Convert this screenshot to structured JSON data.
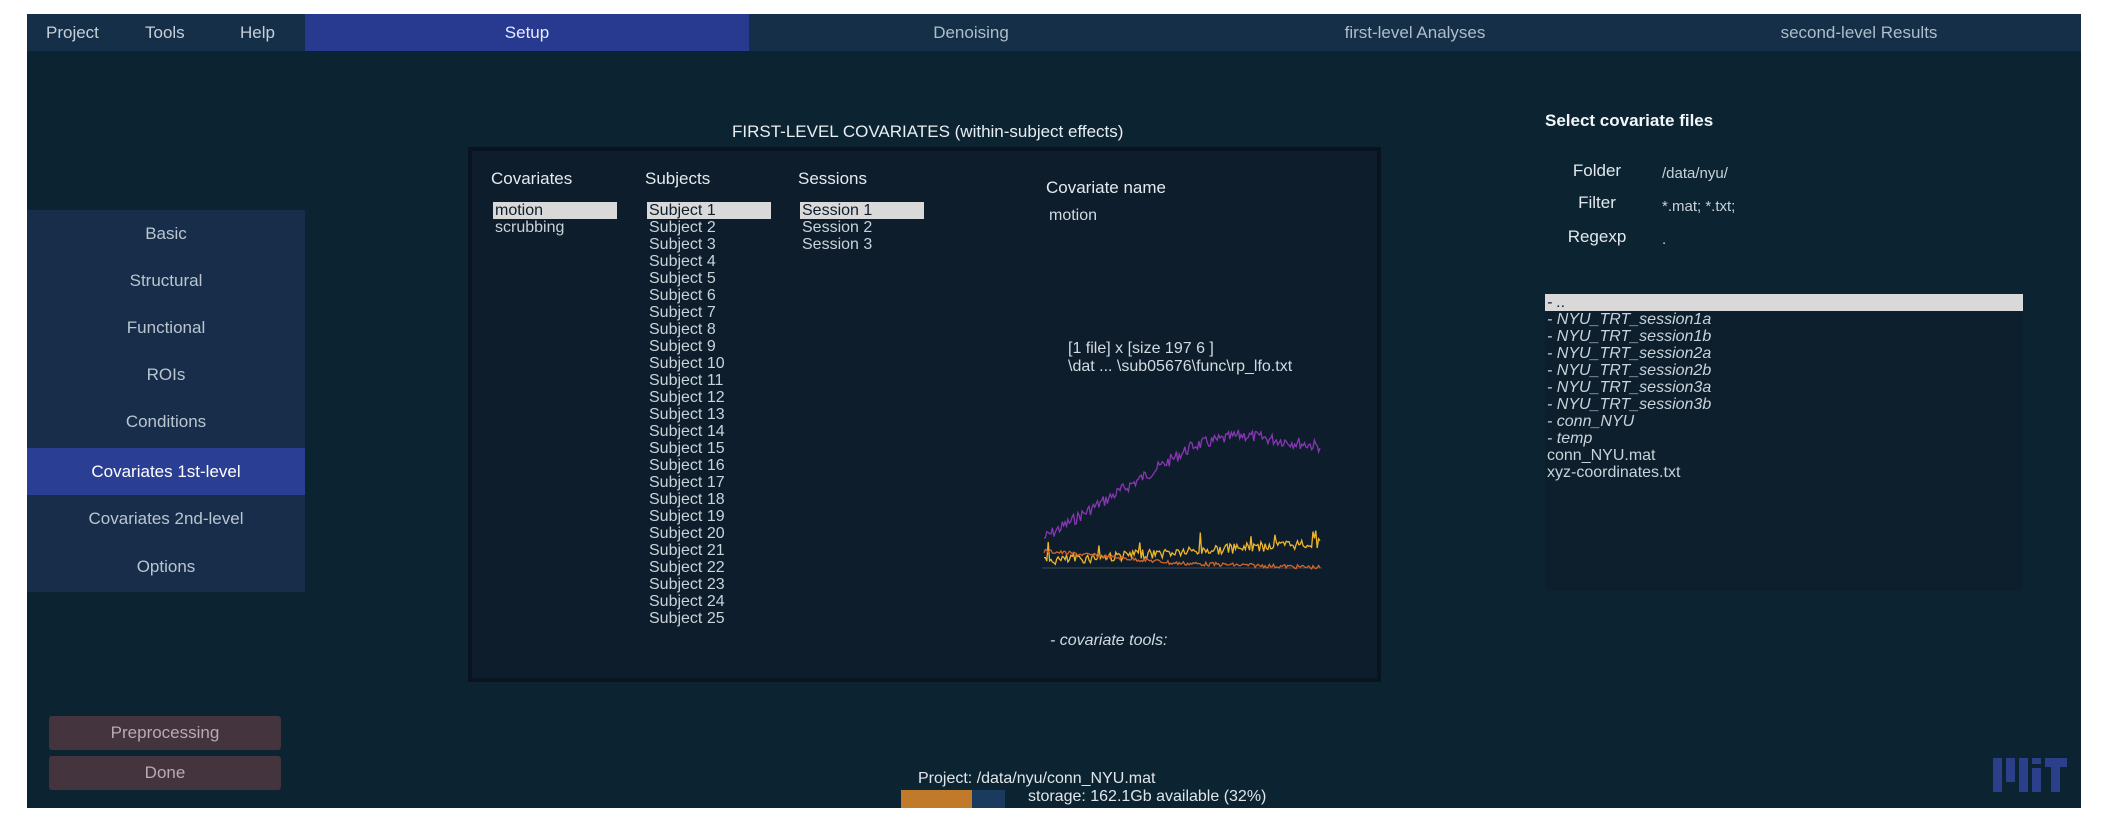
{
  "menu": {
    "project": "Project",
    "tools": "Tools",
    "help": "Help"
  },
  "tabs": [
    {
      "label": "Setup",
      "active": true
    },
    {
      "label": "Denoising",
      "active": false
    },
    {
      "label": "first-level Analyses",
      "active": false
    },
    {
      "label": "second-level Results",
      "active": false
    }
  ],
  "sidebar": {
    "items": [
      "Basic",
      "Structural",
      "Functional",
      "ROIs",
      "Conditions",
      "Covariates 1st-level",
      "Covariates 2nd-level",
      "Options"
    ],
    "active_index": 5
  },
  "bottom_buttons": {
    "preprocessing": "Preprocessing",
    "done": "Done"
  },
  "panel": {
    "title": "FIRST-LEVEL COVARIATES (within-subject effects)",
    "covariates_header": "Covariates",
    "subjects_header": "Subjects",
    "sessions_header": "Sessions",
    "covariates": [
      "motion",
      "scrubbing"
    ],
    "subjects": [
      "Subject  1",
      "Subject  2",
      "Subject  3",
      "Subject  4",
      "Subject  5",
      "Subject  6",
      "Subject  7",
      "Subject  8",
      "Subject  9",
      "Subject 10",
      "Subject 11",
      "Subject 12",
      "Subject 13",
      "Subject 14",
      "Subject 15",
      "Subject 16",
      "Subject 17",
      "Subject 18",
      "Subject 19",
      "Subject 20",
      "Subject 21",
      "Subject 22",
      "Subject 23",
      "Subject 24",
      "Subject 25"
    ],
    "sessions": [
      "Session 1",
      "Session 2",
      "Session 3"
    ],
    "covariate_name_label": "Covariate name",
    "covariate_name_value": "motion",
    "file_info_line1": "[1 file] x [size 197 6 ]",
    "file_info_line2": "\\dat ... \\sub05676\\func\\rp_lfo.txt",
    "covariate_tools": "- covariate tools:",
    "plot_colors": {
      "purple": "#8a35b5",
      "yellow": "#f0b52a",
      "orange": "#d4642a"
    }
  },
  "file_browser": {
    "title": "Select covariate files",
    "folder_label": "Folder",
    "folder_value": "/data/nyu/",
    "filter_label": "Filter",
    "filter_value": "*.mat; *.txt;",
    "regexp_label": "Regexp",
    "regexp_value": ".",
    "items": [
      {
        "name": "- ..",
        "type": "dir",
        "selected": true
      },
      {
        "name": "- NYU_TRT_session1a",
        "type": "dir",
        "selected": false
      },
      {
        "name": "- NYU_TRT_session1b",
        "type": "dir",
        "selected": false
      },
      {
        "name": "- NYU_TRT_session2a",
        "type": "dir",
        "selected": false
      },
      {
        "name": "- NYU_TRT_session2b",
        "type": "dir",
        "selected": false
      },
      {
        "name": "- NYU_TRT_session3a",
        "type": "dir",
        "selected": false
      },
      {
        "name": "- NYU_TRT_session3b",
        "type": "dir",
        "selected": false
      },
      {
        "name": "- conn_NYU",
        "type": "dir",
        "selected": false
      },
      {
        "name": "- temp",
        "type": "dir",
        "selected": false
      },
      {
        "name": "conn_NYU.mat",
        "type": "file",
        "selected": false
      },
      {
        "name": "xyz-coordinates.txt",
        "type": "file",
        "selected": false
      }
    ]
  },
  "footer": {
    "project": "Project: /data/nyu/conn_NYU.mat",
    "storage": "storage: 162.1Gb available (32%)",
    "storage_used_fraction": 0.68
  },
  "colors": {
    "background": "#0c2432",
    "accent": "#283a90",
    "sidebar": "#172d4a"
  }
}
